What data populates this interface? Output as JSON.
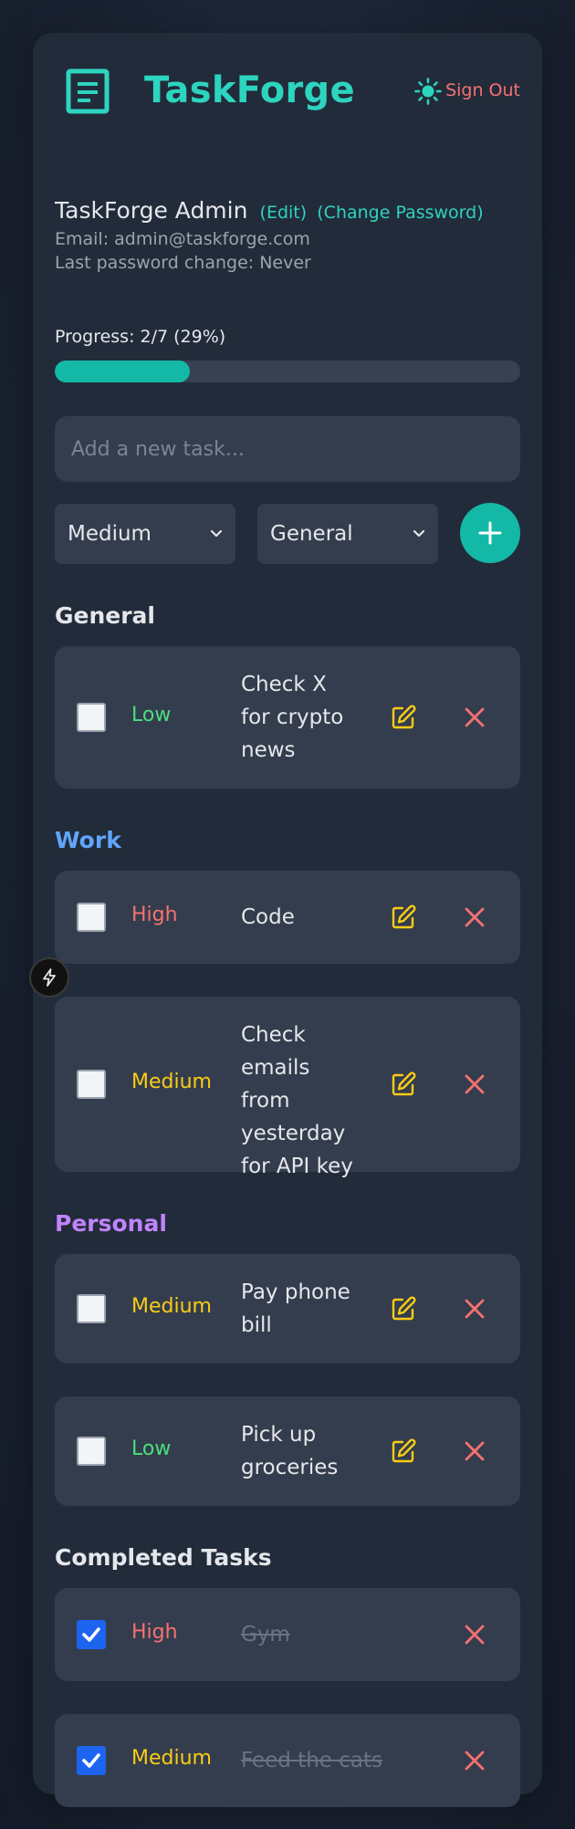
{
  "app": {
    "title": "TaskForge",
    "sign_out": "Sign Out"
  },
  "user": {
    "name": "TaskForge Admin",
    "edit_link": "(Edit)",
    "change_password_link": "(Change Password)",
    "email_line": "Email: admin@taskforge.com",
    "password_line": "Last password change: Never"
  },
  "progress": {
    "label": "Progress: 2/7 (29%)",
    "fraction": 0.29
  },
  "new_task": {
    "placeholder": "Add a new task...",
    "priority_selected": "Medium",
    "category_selected": "General"
  },
  "sections": {
    "general": "General",
    "work": "Work",
    "personal": "Personal",
    "completed": "Completed Tasks"
  },
  "tasks": {
    "general_0": {
      "priority": "Low",
      "text": "Check X for crypto news"
    },
    "work_0": {
      "priority": "High",
      "text": "Code"
    },
    "work_1": {
      "priority": "Medium",
      "text": "Check emails from yesterday for API key"
    },
    "personal_0": {
      "priority": "Medium",
      "text": "Pay phone bill"
    },
    "personal_1": {
      "priority": "Low",
      "text": "Pick up groceries"
    },
    "completed_0": {
      "priority": "High",
      "text": "Gym"
    },
    "completed_1": {
      "priority": "Medium",
      "text": "Feed the cats"
    }
  },
  "colors": {
    "accent": "#2dd4bf",
    "priority_low": "#4ade80",
    "priority_medium": "#facc15",
    "priority_high": "#f87171",
    "work_section": "#60a5fa",
    "personal_section": "#c084fc",
    "edit_icon": "#facc15",
    "delete_icon": "#f87171"
  },
  "icons": {
    "logo": "document-icon",
    "theme": "sun-icon",
    "add": "plus-icon",
    "edit": "edit-icon",
    "delete": "close-icon",
    "dev": "lightning-icon"
  }
}
